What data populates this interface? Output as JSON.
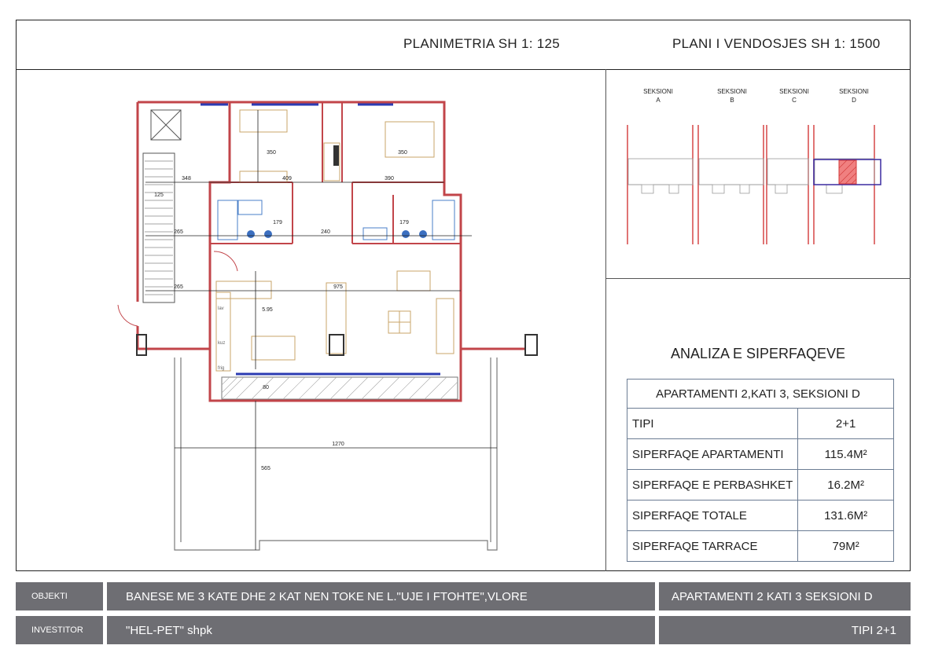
{
  "header": {
    "floorplan_title": "PLANIMETRIA  SH 1: 125",
    "siteplan_title": "PLANI I VENDOSJES SH 1: 1500"
  },
  "site_plan": {
    "sections": [
      {
        "line1": "SEKSIONI",
        "line2": "A"
      },
      {
        "line1": "SEKSIONI",
        "line2": "B"
      },
      {
        "line1": "SEKSIONI",
        "line2": "C"
      },
      {
        "line1": "SEKSIONI",
        "line2": "D"
      }
    ],
    "highlight_color": "#e8383d"
  },
  "floor_plan": {
    "dimensions": [
      "348",
      "409",
      "390",
      "350",
      "350",
      "125",
      "265",
      "240",
      "179",
      "179",
      "265",
      "975",
      "5.95",
      "80",
      "1270",
      "565"
    ],
    "labels": [
      "lav",
      "kuz",
      "frig"
    ],
    "wall_color": "#c2454a",
    "window_color": "#2b3bb3",
    "furniture_color": "#c9a46a"
  },
  "analysis": {
    "title": "ANALIZA E SIPERFAQEVE",
    "table_caption": "APARTAMENTI  2,KATI 3, SEKSIONI D",
    "rows": [
      {
        "label": "TIPI",
        "value": "2+1"
      },
      {
        "label": "SIPERFAQE APARTAMENTI",
        "value": "115.4M²"
      },
      {
        "label": "SIPERFAQE E PERBASHKET",
        "value": "16.2M²"
      },
      {
        "label": "SIPERFAQE TOTALE",
        "value": "131.6M²"
      },
      {
        "label": "SIPERFAQE TARRACE",
        "value": "79M²"
      }
    ]
  },
  "footer": {
    "objekti_label": "OBJEKTI",
    "objekti_value": "BANESE ME 3 KATE DHE 2 KAT NEN TOKE NE L.\"UJE I FTOHTE\",VLORE",
    "apartment": "APARTAMENTI  2 KATI 3 SEKSIONI D",
    "investitor_label": "INVESTITOR",
    "investitor_value": "\"HEL-PET\" shpk",
    "tipi": "TIPI  2+1"
  }
}
